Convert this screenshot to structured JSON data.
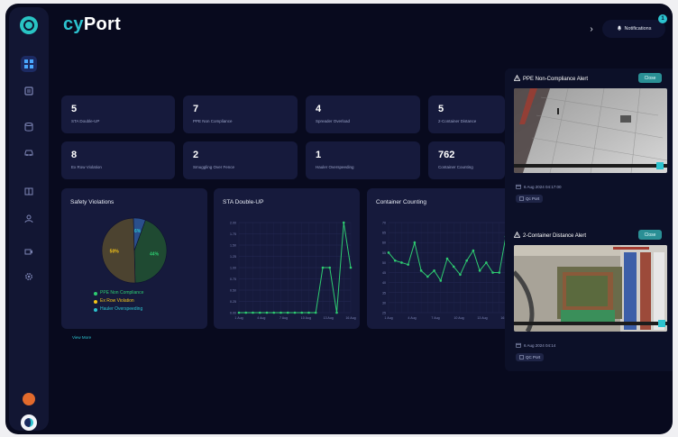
{
  "app": {
    "brand_prefix": "cy",
    "brand_suffix": "Port"
  },
  "topbar": {
    "notifications_label": "Notifications",
    "notifications_count": "1"
  },
  "sidebar": {
    "items": [
      {
        "name": "dashboard",
        "icon": "grid-icon"
      },
      {
        "name": "reports",
        "icon": "document-icon"
      },
      {
        "name": "storage",
        "icon": "database-icon"
      },
      {
        "name": "vehicles",
        "icon": "car-icon"
      },
      {
        "name": "logs",
        "icon": "book-icon"
      },
      {
        "name": "users",
        "icon": "person-icon"
      },
      {
        "name": "cameras",
        "icon": "camera-icon"
      },
      {
        "name": "settings",
        "icon": "gear-icon"
      }
    ],
    "accent": "#4aa8ff"
  },
  "stats": [
    {
      "value": "5",
      "label": "STA Double-UP"
    },
    {
      "value": "7",
      "label": "PPE Non Compliance"
    },
    {
      "value": "4",
      "label": "Spreader Overload"
    },
    {
      "value": "5",
      "label": "2-Container Distance"
    },
    {
      "value": "8",
      "label": "Ex Row Violation"
    },
    {
      "value": "2",
      "label": "Smuggling Over Fence"
    },
    {
      "value": "1",
      "label": "Hauler Overspeeding"
    },
    {
      "value": "762",
      "label": "Container Counting"
    }
  ],
  "panels": {
    "safety": {
      "title": "Safety Violations"
    },
    "sta": {
      "title": "STA Double-UP"
    },
    "container": {
      "title": "Container Counting"
    },
    "view_more": "View More"
  },
  "chart_data": [
    {
      "type": "pie",
      "title": "Safety Violations",
      "slices": [
        {
          "name": "PPE Non Compliance",
          "value": 44,
          "label": "44%",
          "color": "#1f4a32"
        },
        {
          "name": "Ex Row Violation",
          "value": 50,
          "label": "50%",
          "color": "#4c4330"
        },
        {
          "name": "Hauler Overspeeding",
          "value": 6,
          "label": "6%",
          "color": "#2a4f8c"
        }
      ],
      "legend_colors": [
        "#2ecc71",
        "#f5c518",
        "#2cc3cf"
      ],
      "legend": "bottom"
    },
    {
      "type": "line",
      "title": "STA Double-UP",
      "x": [
        "1 Aug",
        "2 Aug",
        "3 Aug",
        "4 Aug",
        "5 Aug",
        "6 Aug",
        "7 Aug",
        "8 Aug",
        "9 Aug",
        "10 Aug",
        "11 Aug",
        "12 Aug",
        "13 Aug",
        "14 Aug",
        "15 Aug",
        "16 Aug",
        "17 Aug"
      ],
      "x_tick_labels": [
        "1 Aug",
        "4 Aug",
        "7 Aug",
        "10 Aug",
        "13 Aug",
        "16 Aug"
      ],
      "values": [
        0,
        0,
        0,
        0,
        0,
        0,
        0,
        0,
        0,
        0,
        0,
        0,
        1,
        1,
        0,
        2,
        1
      ],
      "y_ticks": [
        "2.00",
        "1.75",
        "1.50",
        "1.25",
        "1.00",
        "0.75",
        "0.50",
        "0.25",
        "0.00"
      ],
      "ylim": [
        0,
        2
      ],
      "color": "#2ecc71",
      "grid": true
    },
    {
      "type": "line",
      "title": "Container Counting",
      "x": [
        "1 Aug",
        "2 Aug",
        "3 Aug",
        "4 Aug",
        "5 Aug",
        "6 Aug",
        "7 Aug",
        "8 Aug",
        "9 Aug",
        "10 Aug",
        "11 Aug",
        "12 Aug",
        "13 Aug",
        "14 Aug",
        "15 Aug",
        "16 Aug",
        "17 Aug",
        "18 Aug",
        "19 Aug"
      ],
      "x_tick_labels": [
        "1 Aug",
        "4 Aug",
        "7 Aug",
        "10 Aug",
        "13 Aug",
        "16 Aug"
      ],
      "values": [
        55,
        51,
        50,
        49,
        60,
        46,
        43,
        46,
        41,
        52,
        48,
        44,
        51,
        56,
        46,
        50,
        45,
        45,
        63
      ],
      "y_ticks": [
        "70",
        "65",
        "60",
        "55",
        "50",
        "45",
        "40",
        "35",
        "30",
        "25"
      ],
      "ylim": [
        25,
        70
      ],
      "color": "#2ecc71",
      "grid": true
    }
  ],
  "alerts": [
    {
      "title": "PPE Non-Compliance Alert",
      "close_label": "Close",
      "datetime": "6 Aug 2024 04:17:00",
      "tag": "Qc Port"
    },
    {
      "title": "2-Container Distance Alert",
      "close_label": "Close",
      "datetime": "6 Aug 2024 04:14",
      "tag": "QC Port"
    }
  ],
  "colors": {
    "teal": "#2cc3cf",
    "bg": "#080a1e",
    "card": "#161a3c",
    "green": "#2ecc71"
  }
}
